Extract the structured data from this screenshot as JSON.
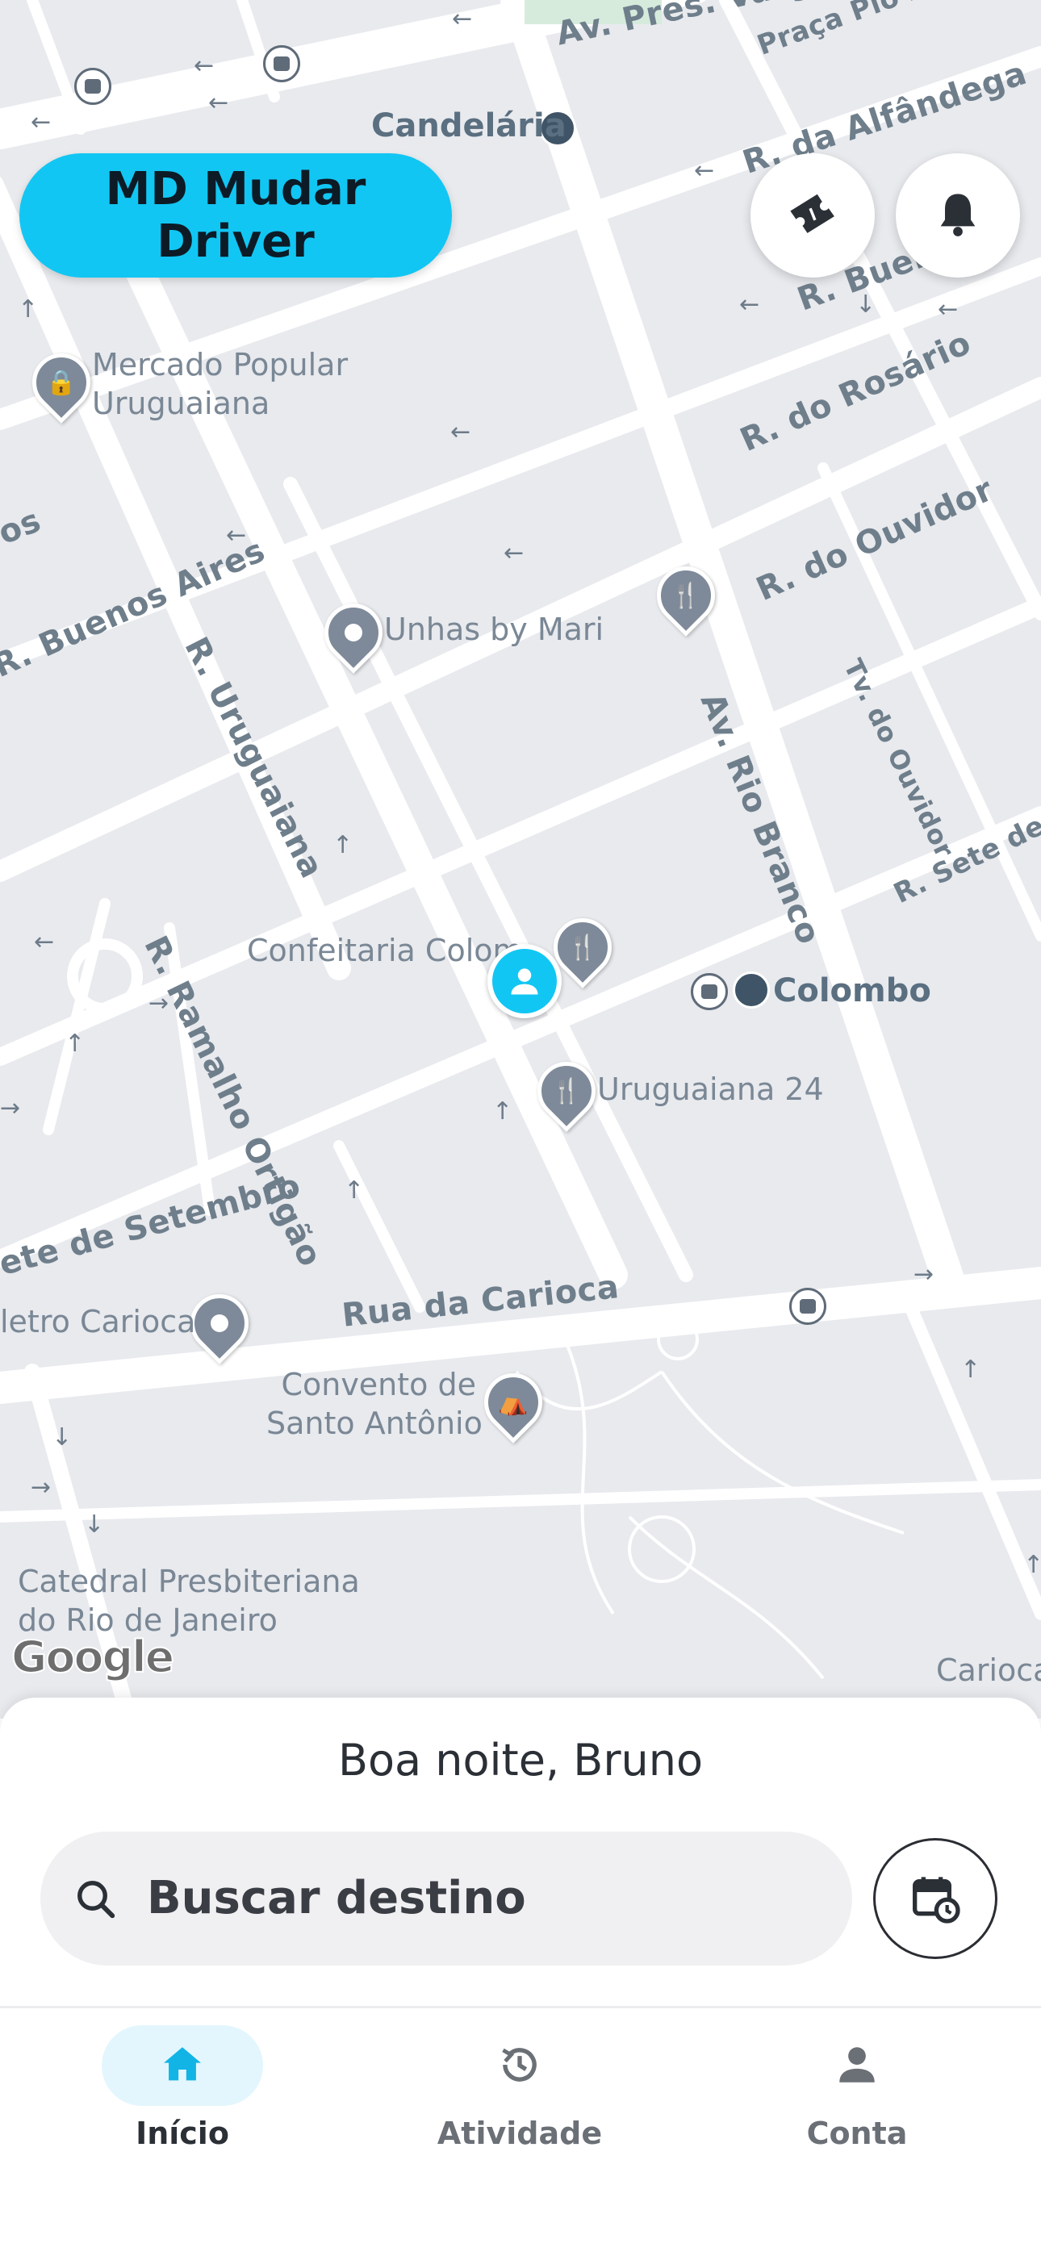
{
  "map": {
    "streets": [
      "Av. Pres. Vargas",
      "Praça Pio X",
      "R. da Alfândega",
      "R. Buenos",
      "R. do Rosário",
      "R. do Ouvidor",
      "Tv. do Ouvidor",
      "R. Sete de Sete",
      "os",
      "R. Buenos Aires",
      "R. Uruguaiana",
      "R. Ramalho Ortigão",
      "Av. Rio Branco",
      "ete de Setembro",
      "Rua da Carioca"
    ],
    "pois": {
      "candelaria": "Candelária",
      "mercado": "Mercado Popular\nUruguaiana",
      "unhas": "Unhas by Mari",
      "confeitaria": "Confeitaria Colom",
      "colombo": "Colombo",
      "uruguaiana24": "Uruguaiana 24",
      "metro_carioca": "letro Carioca",
      "convento": "Convento de\nSanto Antônio",
      "catedral": "Catedral Presbiteriana\ndo Rio de Janeiro",
      "carioca": "Carioca"
    },
    "attribution": "Google"
  },
  "header": {
    "driver_button_label": "MD Mudar Driver",
    "ticket_icon": "ticket-icon",
    "bell_icon": "bell-icon"
  },
  "sheet": {
    "greeting": "Boa noite, Bruno",
    "search_placeholder": "Buscar destino",
    "search_icon": "search-icon",
    "schedule_icon": "calendar-clock-icon"
  },
  "bottom_nav": {
    "items": [
      {
        "label": "Início",
        "icon": "home-icon",
        "active": true
      },
      {
        "label": "Atividade",
        "icon": "history-icon",
        "active": false
      },
      {
        "label": "Conta",
        "icon": "person-icon",
        "active": false
      }
    ]
  },
  "colors": {
    "accent": "#12c6f3",
    "map_bg": "#e8eaee",
    "road": "#ffffff",
    "active_nav_bg": "#e3f6fd",
    "active_nav_fg": "#12b4e6"
  }
}
